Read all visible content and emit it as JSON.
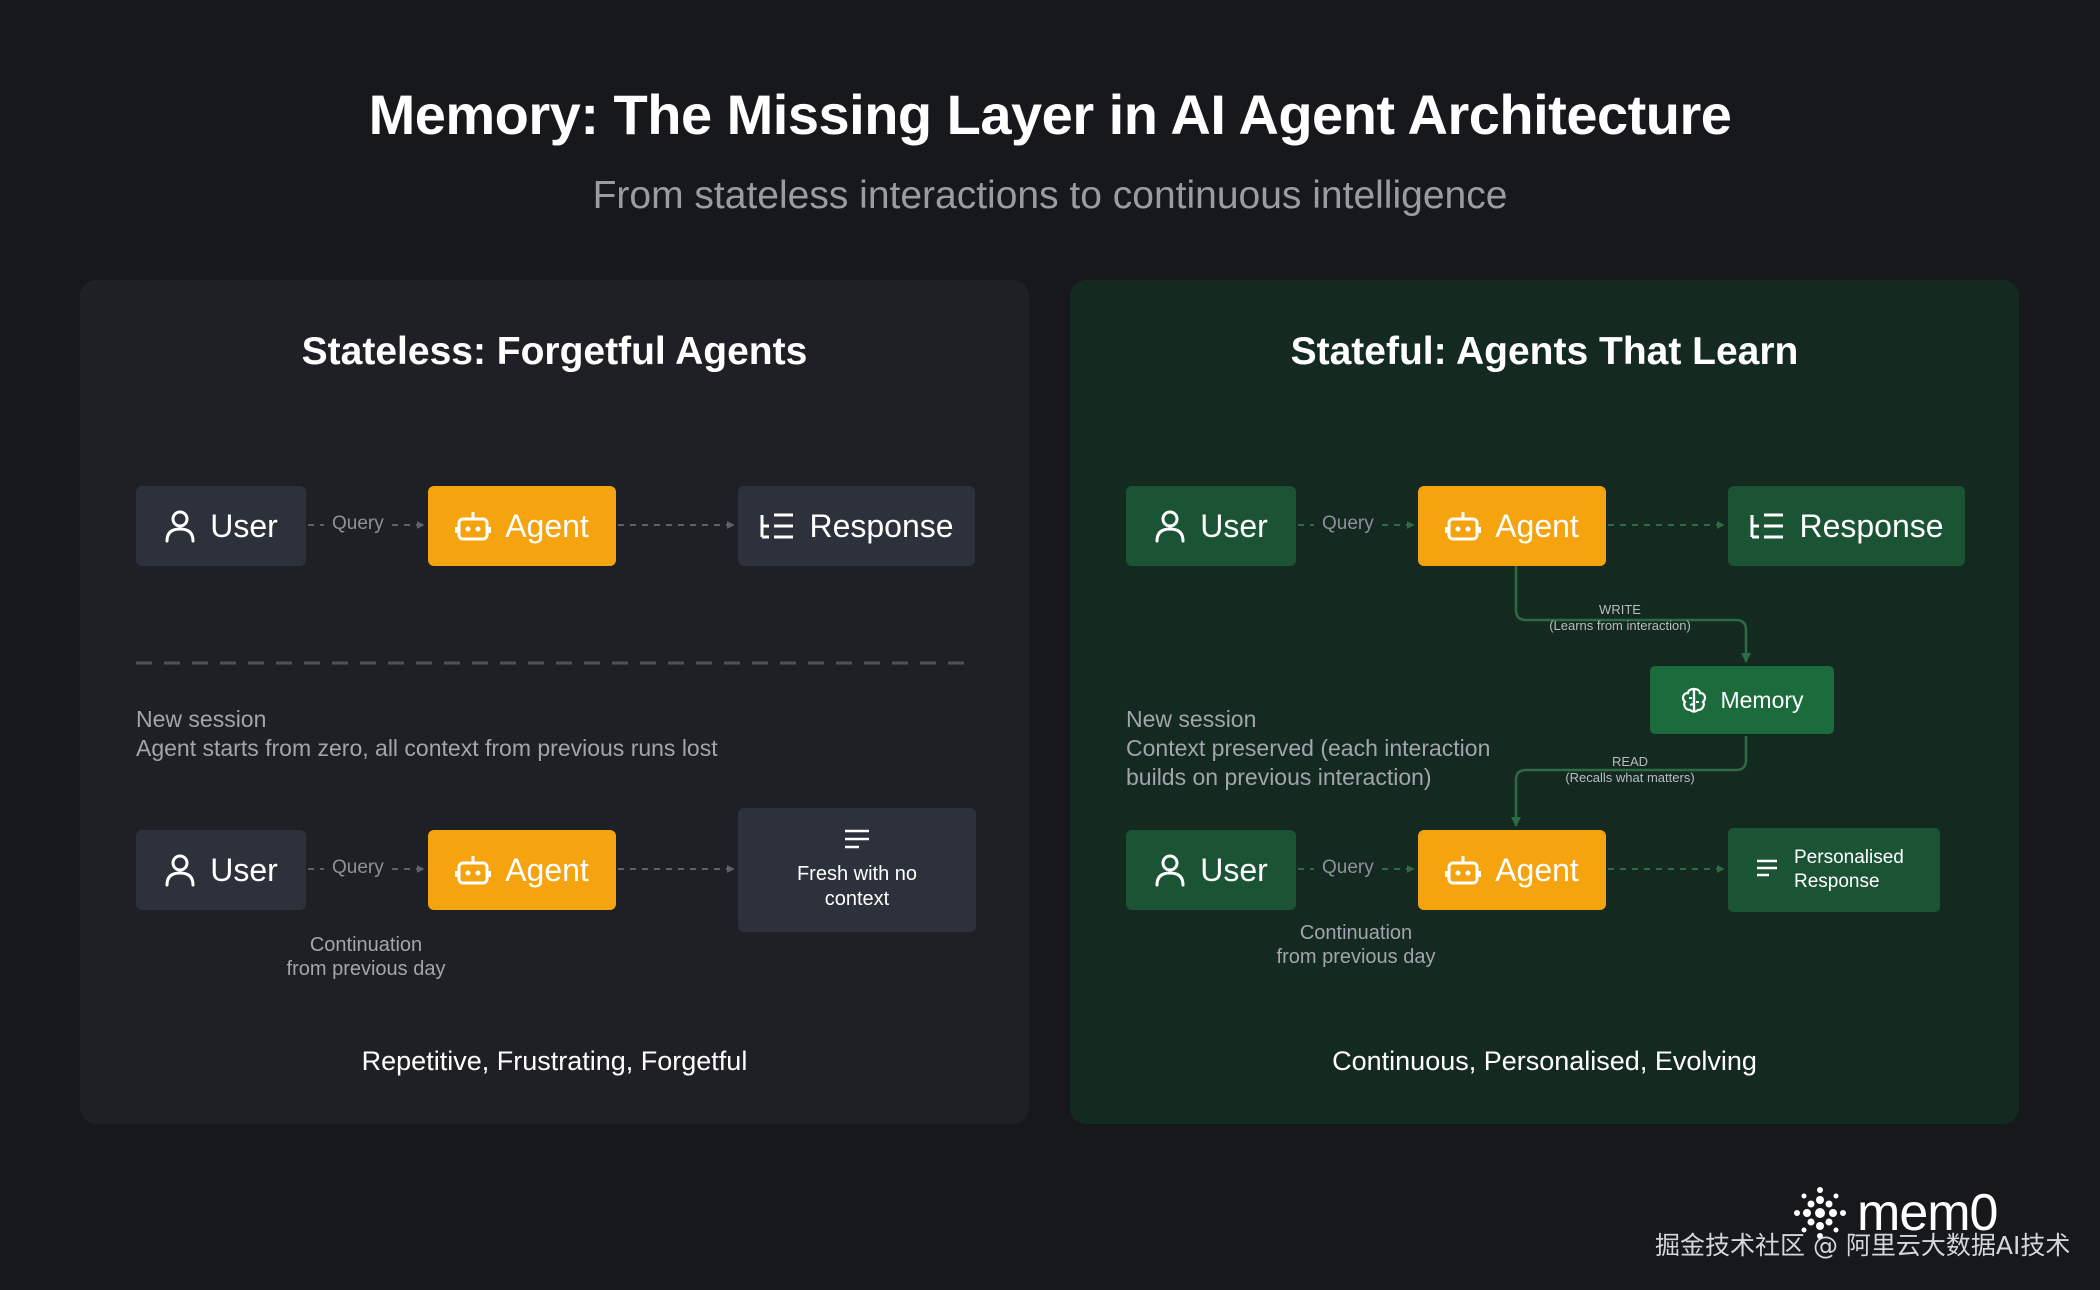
{
  "header": {
    "title": "Memory: The Missing Layer in AI Agent Architecture",
    "subtitle": "From stateless interactions to continuous intelligence"
  },
  "stateless": {
    "title": "Stateless: Forgetful Agents",
    "top_flow": {
      "user": "User",
      "query": "Query",
      "agent": "Agent",
      "response": "Response"
    },
    "session_note": [
      "New session",
      "Agent starts from zero, all context from previous runs lost"
    ],
    "bottom_flow": {
      "user": "User",
      "query": "Query",
      "agent": "Agent",
      "result": [
        "Fresh with no",
        "context"
      ]
    },
    "continuation": [
      "Continuation",
      "from previous day"
    ],
    "footer": "Repetitive, Frustrating, Forgetful"
  },
  "stateful": {
    "title": "Stateful: Agents That Learn",
    "top_flow": {
      "user": "User",
      "query": "Query",
      "agent": "Agent",
      "response": "Response"
    },
    "write_label": [
      "WRITE",
      "(Learns from interaction)"
    ],
    "memory": "Memory",
    "read_label": [
      "READ",
      "(Recalls what matters)"
    ],
    "session_note": [
      "New session",
      "Context preserved (each interaction",
      "builds on previous interaction)"
    ],
    "bottom_flow": {
      "user": "User",
      "query": "Query",
      "agent": "Agent",
      "result": [
        "Personalised",
        "Response"
      ]
    },
    "continuation": [
      "Continuation",
      "from previous day"
    ],
    "footer": "Continuous, Personalised, Evolving"
  },
  "brand": {
    "name": "mem0"
  },
  "watermark": "掘金技术社区 @ 阿里云大数据AI技术",
  "colors": {
    "background": "#17181c",
    "panel_stateless": "#1f2026",
    "panel_stateful": "#14291f",
    "agent": "#f5a30f",
    "node_gray": "#2c313b",
    "node_green": "#1b5434",
    "memory": "#1b6b3c"
  },
  "icons": {
    "user": "user-icon",
    "agent": "robot-icon",
    "response": "list-icon",
    "fresh": "text-lines-icon",
    "memory": "brain-icon",
    "personalised": "text-lines-icon"
  }
}
